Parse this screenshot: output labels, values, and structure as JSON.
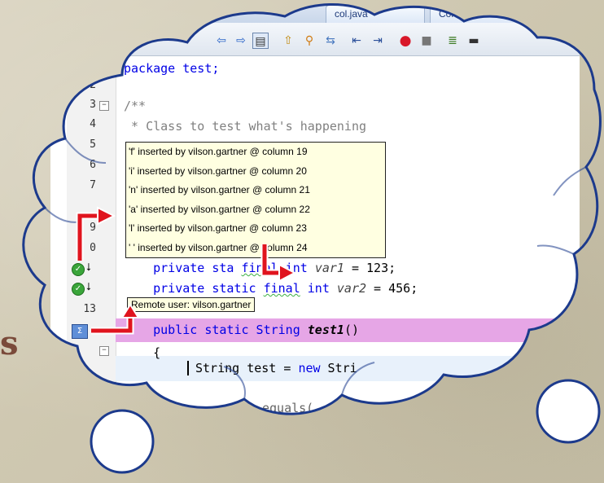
{
  "tabs": [
    "col.java",
    "ContactList"
  ],
  "toolbar_icons": [
    "back-icon",
    "forward-icon",
    "history-icon",
    "up-icon",
    "find-icon",
    "replace-icon",
    "shift-left-icon",
    "shift-right-icon",
    "record-icon",
    "stop-icon",
    "format-icon",
    "comment-icon"
  ],
  "line_numbers": [
    "2",
    "3",
    "4",
    "5",
    "6",
    "7",
    "9",
    "0",
    "13"
  ],
  "code": {
    "l1": "package test;",
    "l3": "/**",
    "l4": " * Class to test what's happening",
    "l11_a": "    private sta",
    "l11_final": "final",
    "l11_b": " int ",
    "l11_var": "var1",
    "l11_c": " = 123;",
    "l12_a": "    private static ",
    "l12_final": "final",
    "l12_b": " int ",
    "l12_var": "var2",
    "l12_c": " = 456;",
    "l14_a": "    public static String ",
    "l14_method": "test1",
    "l14_b": "()",
    "l15": "    {",
    "l16_a": "String test = ",
    "l16_new": "new",
    "l16_b": " Stri",
    "l18": "equals("
  },
  "tooltip_lines": [
    "'f' inserted by vilson.gartner @ column 19",
    "'i' inserted by vilson.gartner @ column 20",
    "'n' inserted by vilson.gartner @ column 21",
    "'a' inserted by vilson.gartner @ column 22",
    "'l' inserted by vilson.gartner @ column 23",
    "' ' inserted by vilson.gartner @ column 24"
  ],
  "remote_user": "Remote user: vilson.gartner",
  "partial_letter": "s",
  "colors": {
    "highlight": "#e6a6e6",
    "tooltip_bg": "#ffffe1",
    "arrow": "#e0141e",
    "cloud_outline": "#1c3a8c"
  }
}
